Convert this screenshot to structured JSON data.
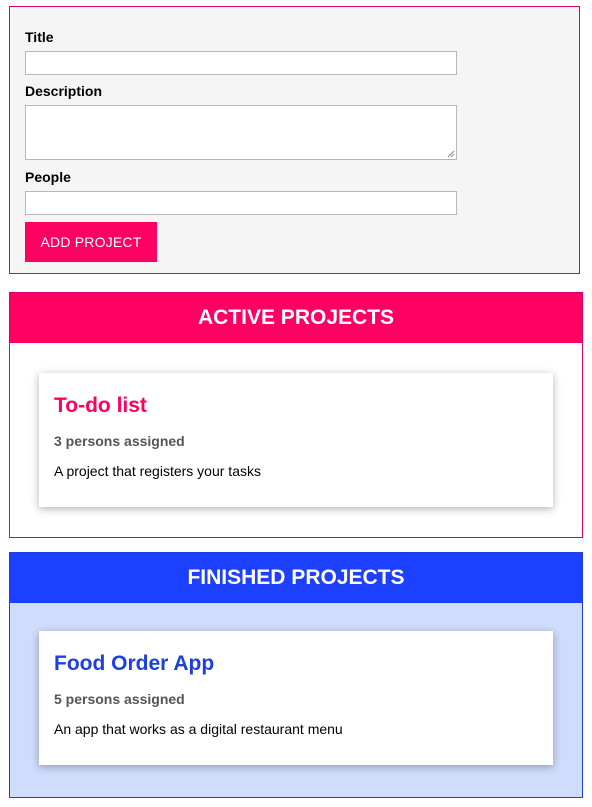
{
  "form": {
    "title_label": "Title",
    "title_value": "",
    "description_label": "Description",
    "description_value": "",
    "people_label": "People",
    "people_value": "",
    "add_button_label": "ADD PROJECT"
  },
  "active": {
    "heading": "ACTIVE PROJECTS",
    "accent_color": "#ff0062",
    "projects": [
      {
        "title": "To-do list",
        "assigned": "3 persons assigned",
        "description": "A project that registers your tasks"
      }
    ]
  },
  "finished": {
    "heading": "FINISHED PROJECTS",
    "accent_color": "#1d3fff",
    "background_color": "#d0dcfb",
    "projects": [
      {
        "title": "Food Order App",
        "assigned": "5 persons assigned",
        "description": "An app that works as a digital restaurant menu"
      }
    ]
  }
}
